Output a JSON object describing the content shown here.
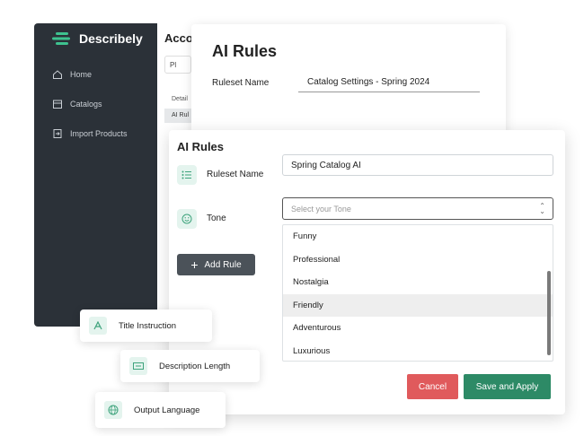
{
  "app": {
    "brand": "Describely",
    "nav": [
      {
        "label": "Home",
        "icon": "home-icon"
      },
      {
        "label": "Catalogs",
        "icon": "store-icon"
      },
      {
        "label": "Import Products",
        "icon": "import-icon"
      }
    ],
    "account_title": "Accou",
    "chip_text": "Pl",
    "detail_text": "Detail",
    "ai_tab": "AI Rul"
  },
  "back_card": {
    "title": "AI Rules",
    "ruleset_label": "Ruleset Name",
    "ruleset_value": "Catalog Settings - Spring 2024"
  },
  "front_card": {
    "title": "AI Rules",
    "ruleset_label": "Ruleset Name",
    "ruleset_value": "Spring Catalog AI",
    "tone_label": "Tone",
    "tone_placeholder": "Select your Tone",
    "add_rule": "Add Rule",
    "tone_options": [
      "Funny",
      "Professional",
      "Nostalgia",
      "Friendly",
      "Adventurous",
      "Luxurious"
    ],
    "selected_option": "Friendly",
    "cancel": "Cancel",
    "apply": "Save and Apply"
  },
  "chips": [
    {
      "label": "Title Instruction",
      "icon": "text-icon"
    },
    {
      "label": "Description Length",
      "icon": "length-icon"
    },
    {
      "label": "Output Language",
      "icon": "globe-icon"
    }
  ],
  "colors": {
    "sidebar": "#2b3138",
    "accent_green": "#2d8a66",
    "cancel_red": "#e05a5c",
    "icon_tint": "#e4f4ee"
  }
}
